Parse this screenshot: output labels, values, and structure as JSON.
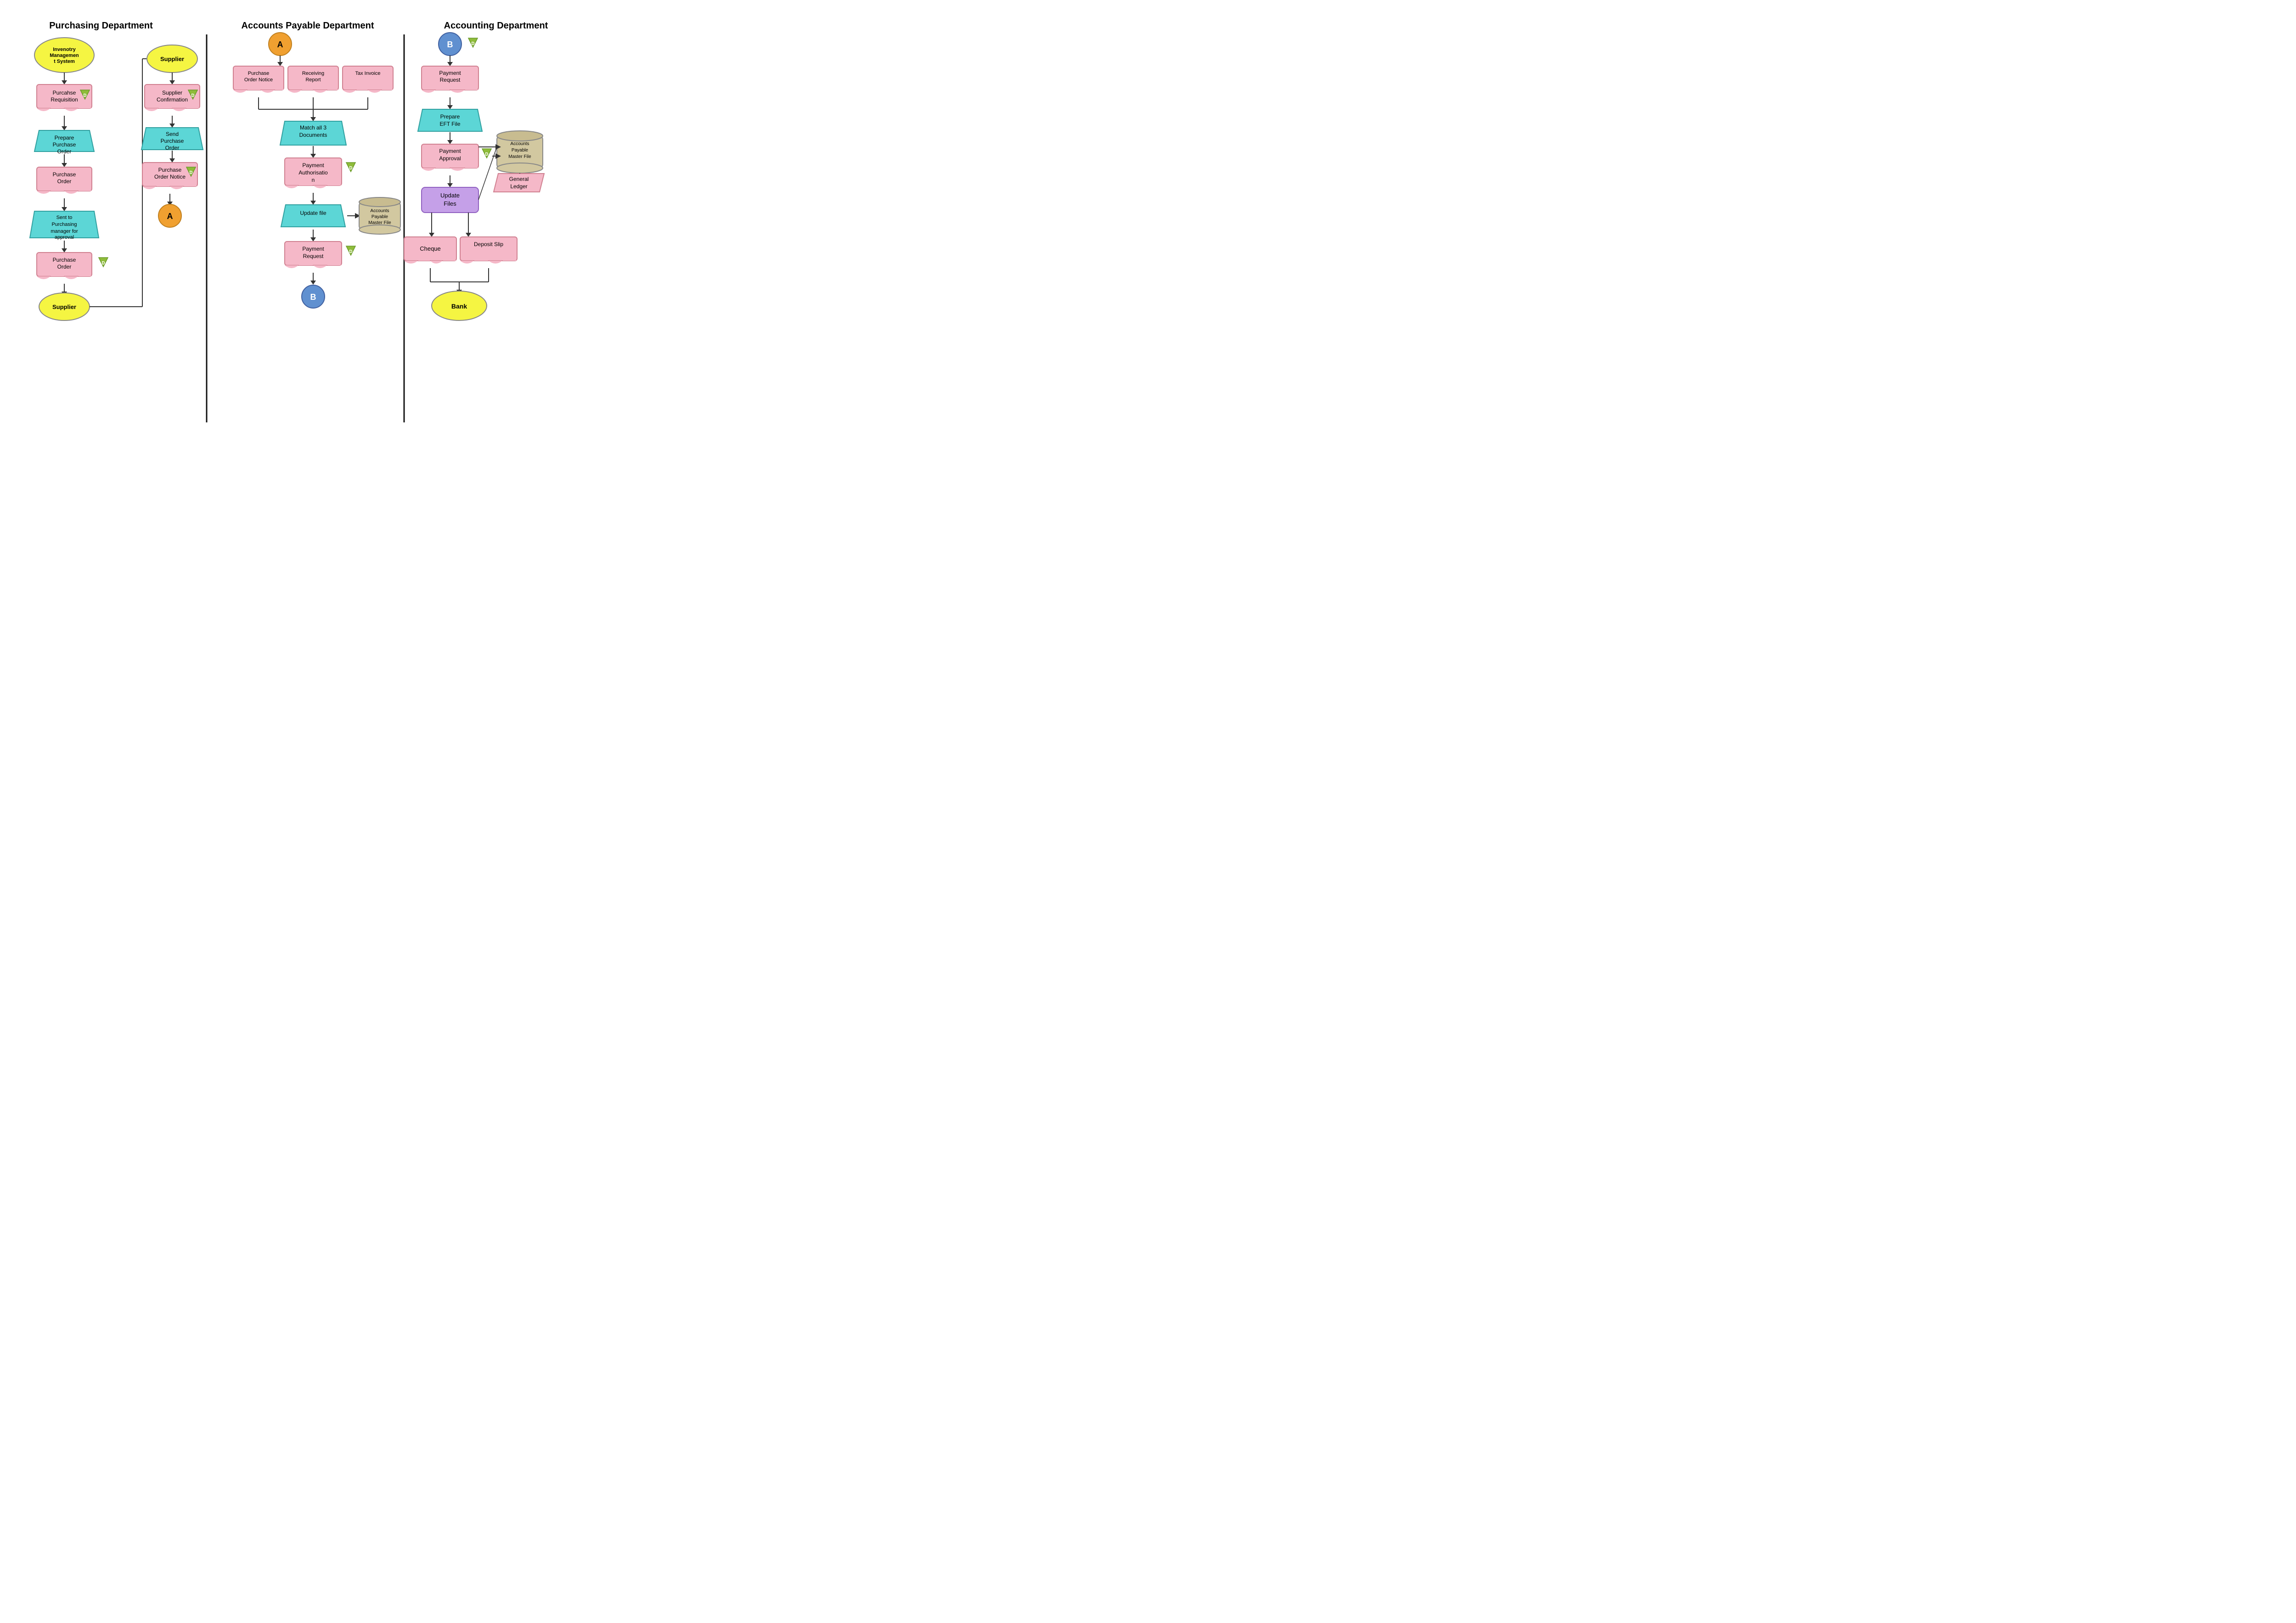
{
  "departments": {
    "purchasing": {
      "title": "Purchasing Department",
      "left_col": {
        "items": [
          {
            "id": "inventory-system",
            "type": "ellipse",
            "label": "Invenotry Management System",
            "color": "#f5f542"
          },
          {
            "id": "purchase-req",
            "type": "wave",
            "label": "Purcahse Requisition",
            "color": "#f5b8c8"
          },
          {
            "id": "prepare-po",
            "type": "trapezoid",
            "label": "Prepare Purchase Order",
            "color": "#5cd6d6"
          },
          {
            "id": "purchase-order-1",
            "type": "wave",
            "label": "Purchase Order",
            "color": "#f5b8c8"
          },
          {
            "id": "sent-to-manager",
            "type": "trapezoid",
            "label": "Sent to Purchasing manager for approval",
            "color": "#5cd6d6"
          },
          {
            "id": "purchase-order-2",
            "type": "wave",
            "label": "Purchase Order",
            "color": "#f5b8c8"
          },
          {
            "id": "supplier-ellipse",
            "type": "ellipse",
            "label": "Supplier",
            "color": "#f5f542"
          }
        ]
      },
      "right_col": {
        "items": [
          {
            "id": "supplier-top",
            "type": "ellipse",
            "label": "Supplier",
            "color": "#f5f542"
          },
          {
            "id": "supplier-confirm",
            "type": "wave",
            "label": "Supplier Confirmation",
            "color": "#f5b8c8"
          },
          {
            "id": "send-po",
            "type": "trapezoid",
            "label": "Send Purchase Order",
            "color": "#5cd6d6"
          },
          {
            "id": "po-notice",
            "type": "wave",
            "label": "Purchase Order Notice",
            "color": "#f5b8c8"
          },
          {
            "id": "connector-a",
            "type": "circle",
            "label": "A",
            "color": "#f0a030"
          }
        ]
      }
    },
    "accounts_payable": {
      "title": "Accounts Payable Department",
      "items": [
        {
          "id": "conn-a-top",
          "type": "circle",
          "label": "A",
          "color": "#f0a030"
        },
        {
          "id": "po-notice-doc",
          "type": "wave",
          "label": "Purchase Order Notice",
          "color": "#f5b8c8"
        },
        {
          "id": "receiving-report-doc",
          "type": "wave",
          "label": "Receiving Report",
          "color": "#f5b8c8"
        },
        {
          "id": "tax-invoice-doc",
          "type": "wave",
          "label": "Tax Invoice",
          "color": "#f5b8c8"
        },
        {
          "id": "match-docs",
          "type": "trapezoid",
          "label": "Match all 3 Documents",
          "color": "#5cd6d6"
        },
        {
          "id": "payment-auth",
          "type": "wave",
          "label": "Payment Authorisation",
          "color": "#f5b8c8"
        },
        {
          "id": "update-file",
          "type": "trapezoid",
          "label": "Update file",
          "color": "#5cd6d6"
        },
        {
          "id": "ap-master-file",
          "type": "cylinder",
          "label": "Accounts Payable Master File",
          "color": "#d2c8a0"
        },
        {
          "id": "payment-request-ap",
          "type": "wave",
          "label": "Payment Request",
          "color": "#f5b8c8"
        },
        {
          "id": "conn-b-bottom",
          "type": "circle",
          "label": "B",
          "color": "#6090d0"
        }
      ]
    },
    "accounting": {
      "title": "Accounting Department",
      "items": [
        {
          "id": "conn-b-top",
          "type": "circle",
          "label": "B",
          "color": "#6090d0"
        },
        {
          "id": "payment-request-acc",
          "type": "wave",
          "label": "Payment Request",
          "color": "#f5b8c8"
        },
        {
          "id": "prepare-eft",
          "type": "trapezoid",
          "label": "Prepare EFT File",
          "color": "#5cd6d6"
        },
        {
          "id": "payment-approval",
          "type": "wave",
          "label": "Payment Approval",
          "color": "#f5b8c8"
        },
        {
          "id": "update-files",
          "type": "rounded-rect",
          "label": "Update Files",
          "color": "#c5a0e8"
        },
        {
          "id": "ap-master-file-acc",
          "type": "cylinder",
          "label": "Accounts Payable Master File",
          "color": "#d2c8a0"
        },
        {
          "id": "general-ledger",
          "type": "parallelogram",
          "label": "General Ledger",
          "color": "#f5b8c8"
        },
        {
          "id": "cheque",
          "type": "wave",
          "label": "Cheque",
          "color": "#f5b8c8"
        },
        {
          "id": "deposit-slip",
          "type": "wave",
          "label": "Deposit Slip",
          "color": "#f5b8c8"
        },
        {
          "id": "bank",
          "type": "ellipse",
          "label": "Bank",
          "color": "#f5f542"
        }
      ]
    }
  },
  "d_markers": {
    "label": "D",
    "color": "#8fbc3a"
  }
}
